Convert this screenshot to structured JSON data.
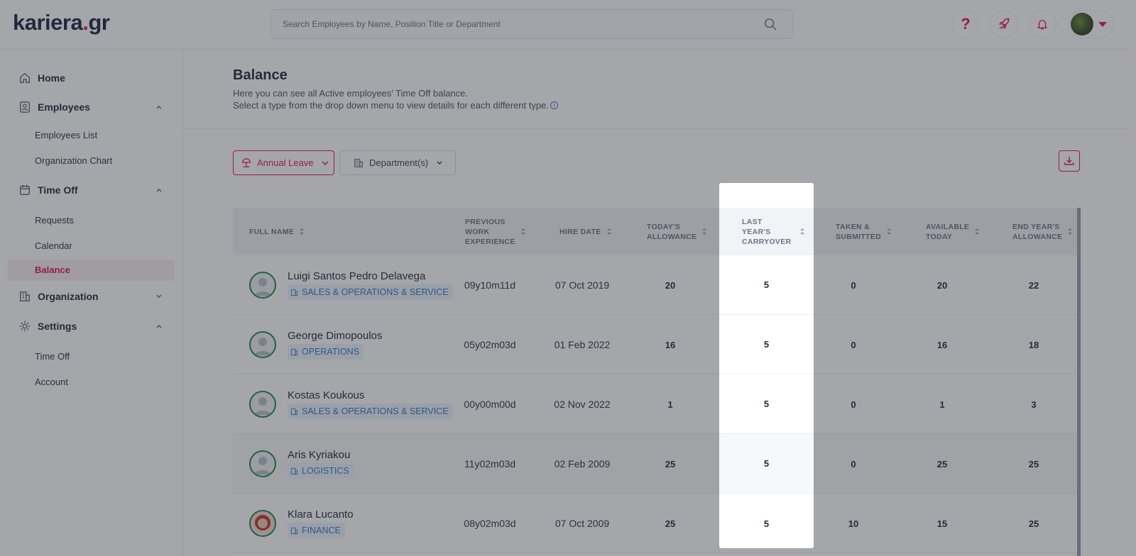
{
  "brand": {
    "name": "kariera",
    "dot": ".",
    "tld": "gr"
  },
  "search": {
    "placeholder": "Search Employees by Name, Position Title or Department"
  },
  "topbar": {
    "help_label": "?"
  },
  "sidebar": {
    "home": "Home",
    "employees": "Employees",
    "employees_list": "Employees List",
    "org_chart": "Organization Chart",
    "time_off": "Time Off",
    "requests": "Requests",
    "calendar": "Calendar",
    "balance": "Balance",
    "organization": "Organization",
    "settings": "Settings",
    "settings_time_off": "Time Off",
    "account": "Account"
  },
  "page": {
    "title": "Balance",
    "desc_line1": "Here you can see all Active employees' Time Off balance.",
    "desc_line2": "Select a type from the drop down menu to view details for each different type."
  },
  "filters": {
    "leave_type": "Annual Leave",
    "department": "Department(s)"
  },
  "table": {
    "headers": {
      "full_name": "FULL NAME",
      "prev_exp_1": "PREVIOUS",
      "prev_exp_2": "WORK",
      "prev_exp_3": "EXPERIENCE",
      "hire_date": "HIRE DATE",
      "today_1": "TODAY'S",
      "today_2": "ALLOWANCE",
      "carry_1": "LAST",
      "carry_2": "YEAR'S",
      "carry_3": "CARRYOVER",
      "taken_1": "TAKEN &",
      "taken_2": "SUBMITTED",
      "avail_1": "AVAILABLE",
      "avail_2": "TODAY",
      "end_1": "END YEAR'S",
      "end_2": "ALLOWANCE"
    },
    "rows": [
      {
        "name": "Luigi Santos Pedro Delavega",
        "dept": "SALES & OPERATIONS & SERVICE",
        "prev": "09y10m11d",
        "hire": "07 Oct 2019",
        "today": "20",
        "carry": "5",
        "taken": "0",
        "available": "20",
        "end": "22"
      },
      {
        "name": "George Dimopoulos",
        "dept": "OPERATIONS",
        "prev": "05y02m03d",
        "hire": "01 Feb 2022",
        "today": "16",
        "carry": "5",
        "taken": "0",
        "available": "16",
        "end": "18"
      },
      {
        "name": "Kostas Koukous",
        "dept": "SALES & OPERATIONS & SERVICE",
        "prev": "00y00m00d",
        "hire": "02 Nov 2022",
        "today": "1",
        "carry": "5",
        "taken": "0",
        "available": "1",
        "end": "3"
      },
      {
        "name": "Aris Kyriakou",
        "dept": "LOGISTICS",
        "prev": "11y02m03d",
        "hire": "02 Feb 2009",
        "today": "25",
        "carry": "5",
        "taken": "0",
        "available": "25",
        "end": "25"
      },
      {
        "name": "Klara Lucanto",
        "dept": "FINANCE",
        "prev": "08y02m03d",
        "hire": "07 Oct 2009",
        "today": "25",
        "carry": "5",
        "taken": "10",
        "available": "15",
        "end": "25"
      }
    ]
  },
  "colors": {
    "accent": "#e0184d",
    "navy": "#1c2847",
    "dept_blue": "#2b7ac9",
    "avatar_ring": "#1b8a4f"
  }
}
